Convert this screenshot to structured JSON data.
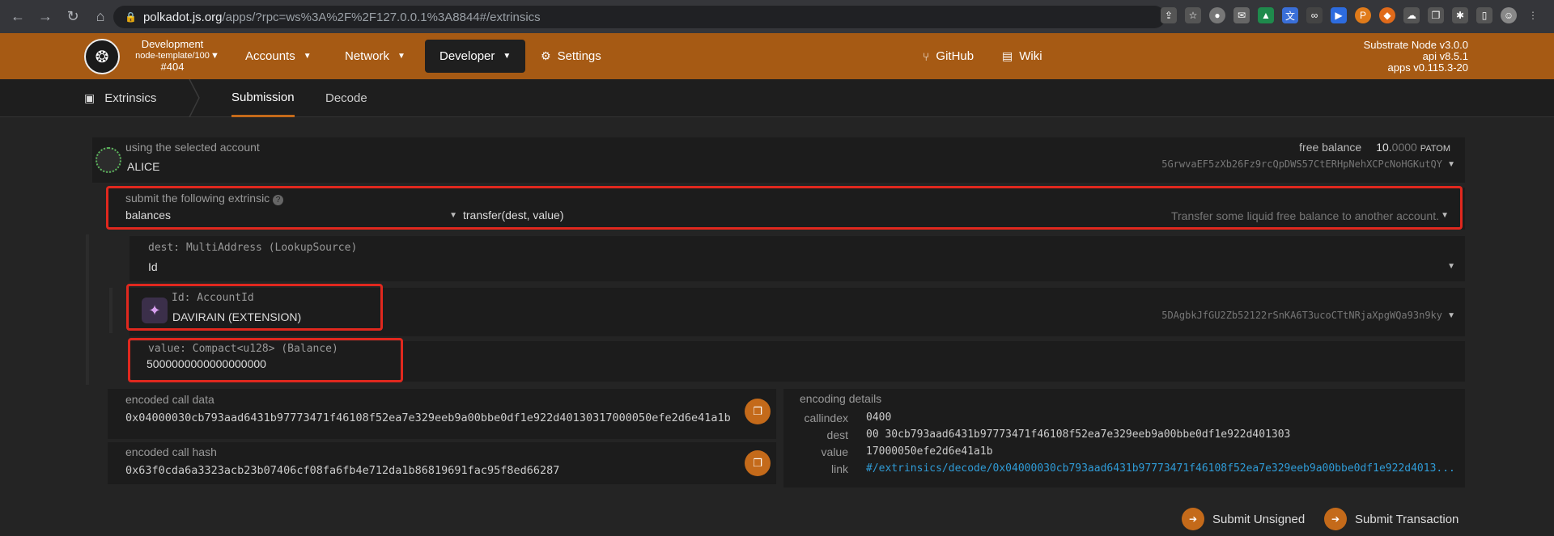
{
  "browser": {
    "url_host": "polkadot.js.org",
    "url_rest": "/apps/?rpc=ws%3A%2F%2F127.0.0.1%3A8844#/extrinsics"
  },
  "header": {
    "chain_name": "Development",
    "chain_sub": "node-template/100",
    "block": "#404",
    "menu": {
      "accounts": "Accounts",
      "network": "Network",
      "developer": "Developer",
      "settings": "Settings",
      "github": "GitHub",
      "wiki": "Wiki"
    },
    "versions": [
      "Substrate Node v3.0.0",
      "api v8.5.1",
      "apps v0.115.3-20"
    ]
  },
  "subnav": {
    "section": "Extrinsics",
    "tabs": [
      "Submission",
      "Decode"
    ]
  },
  "account": {
    "label": "using the selected account",
    "name": "ALICE",
    "free_balance_label": "free balance",
    "balance_int": "10.",
    "balance_frac": "0000",
    "balance_unit": "PATOM",
    "address": "5GrwvaEF5zXb26Fz9rcQpDWS57CtERHpNehXCPcNoHGKutQY"
  },
  "extrinsic": {
    "label": "submit the following extrinsic",
    "module": "balances",
    "method": "transfer(dest, value)",
    "description": "Transfer some liquid free balance to another account."
  },
  "dest": {
    "label": "dest: MultiAddress (LookupSource)",
    "value": "Id"
  },
  "id_field": {
    "label": "Id: AccountId",
    "name": "DAVIRAIN (EXTENSION)",
    "address": "5DAgbkJfGU2Zb52122rSnKA6T3ucoCTtNRjaXpgWQa93n9ky"
  },
  "value_field": {
    "label": "value: Compact<u128> (Balance)",
    "value": "5000000000000000000"
  },
  "encoded": {
    "call_data_label": "encoded call data",
    "call_data": "0x04000030cb793aad6431b97773471f46108f52ea7e329eeb9a00bbe0df1e922d40130317000050efe2d6e41a1b",
    "call_hash_label": "encoded call hash",
    "call_hash": "0x63f0cda6a3323acb23b07406cf08fa6fb4e712da1b86819691fac95f8ed66287"
  },
  "encoding_details": {
    "title": "encoding details",
    "rows": [
      {
        "key": "callindex",
        "value": "0400"
      },
      {
        "key": "dest",
        "value": "00 30cb793aad6431b97773471f46108f52ea7e329eeb9a00bbe0df1e922d401303"
      },
      {
        "key": "value",
        "value": "17000050efe2d6e41a1b"
      },
      {
        "key": "link",
        "value": "#/extrinsics/decode/0x04000030cb793aad6431b97773471f46108f52ea7e329eeb9a00bbe0df1e922d4013..."
      }
    ]
  },
  "actions": {
    "submit_unsigned": "Submit Unsigned",
    "submit_transaction": "Submit Transaction"
  },
  "colors": {
    "header_bg": "#a65a14",
    "accent": "#c46a1a",
    "highlight": "#e0281e",
    "link": "#2f9bd6"
  }
}
